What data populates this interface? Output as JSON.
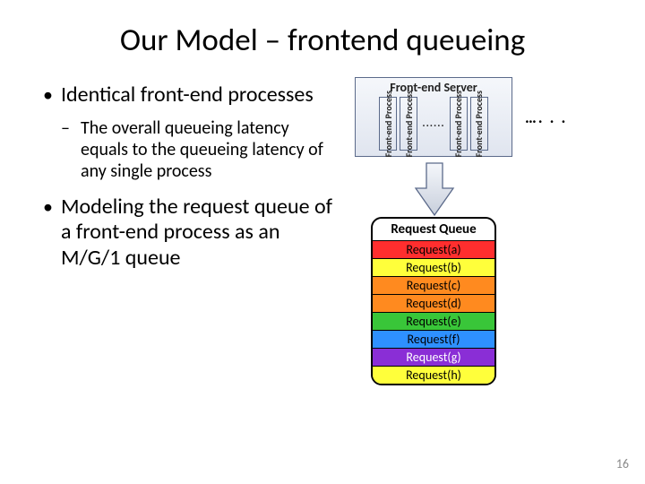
{
  "title": "Our Model – frontend queueing",
  "bullets": {
    "b1": "Identical front-end processes",
    "b1_sub": "The overall queueing latency equals to the queueing latency of any single process",
    "b2": "Modeling the request queue of a front-end process as an M/G/1 queue"
  },
  "diagram": {
    "server_label": "Front-end Server",
    "process_label": "Front-end Process",
    "inner_dots": "......",
    "outer_dots": "…. . .",
    "queue_title": "Request Queue",
    "requests": [
      {
        "label": "Request(a)",
        "bg": "#ff2e2e"
      },
      {
        "label": "Request(b)",
        "bg": "#ffff3b"
      },
      {
        "label": "Request(c)",
        "bg": "#ff8a1f"
      },
      {
        "label": "Request(d)",
        "bg": "#ff8a1f"
      },
      {
        "label": "Request(e)",
        "bg": "#39c639"
      },
      {
        "label": "Request(f)",
        "bg": "#2e90ff"
      },
      {
        "label": "Request(g)",
        "bg": "#8a2ed6"
      },
      {
        "label": "Request(h)",
        "bg": "#ffff3b"
      }
    ]
  },
  "page_number": "16"
}
